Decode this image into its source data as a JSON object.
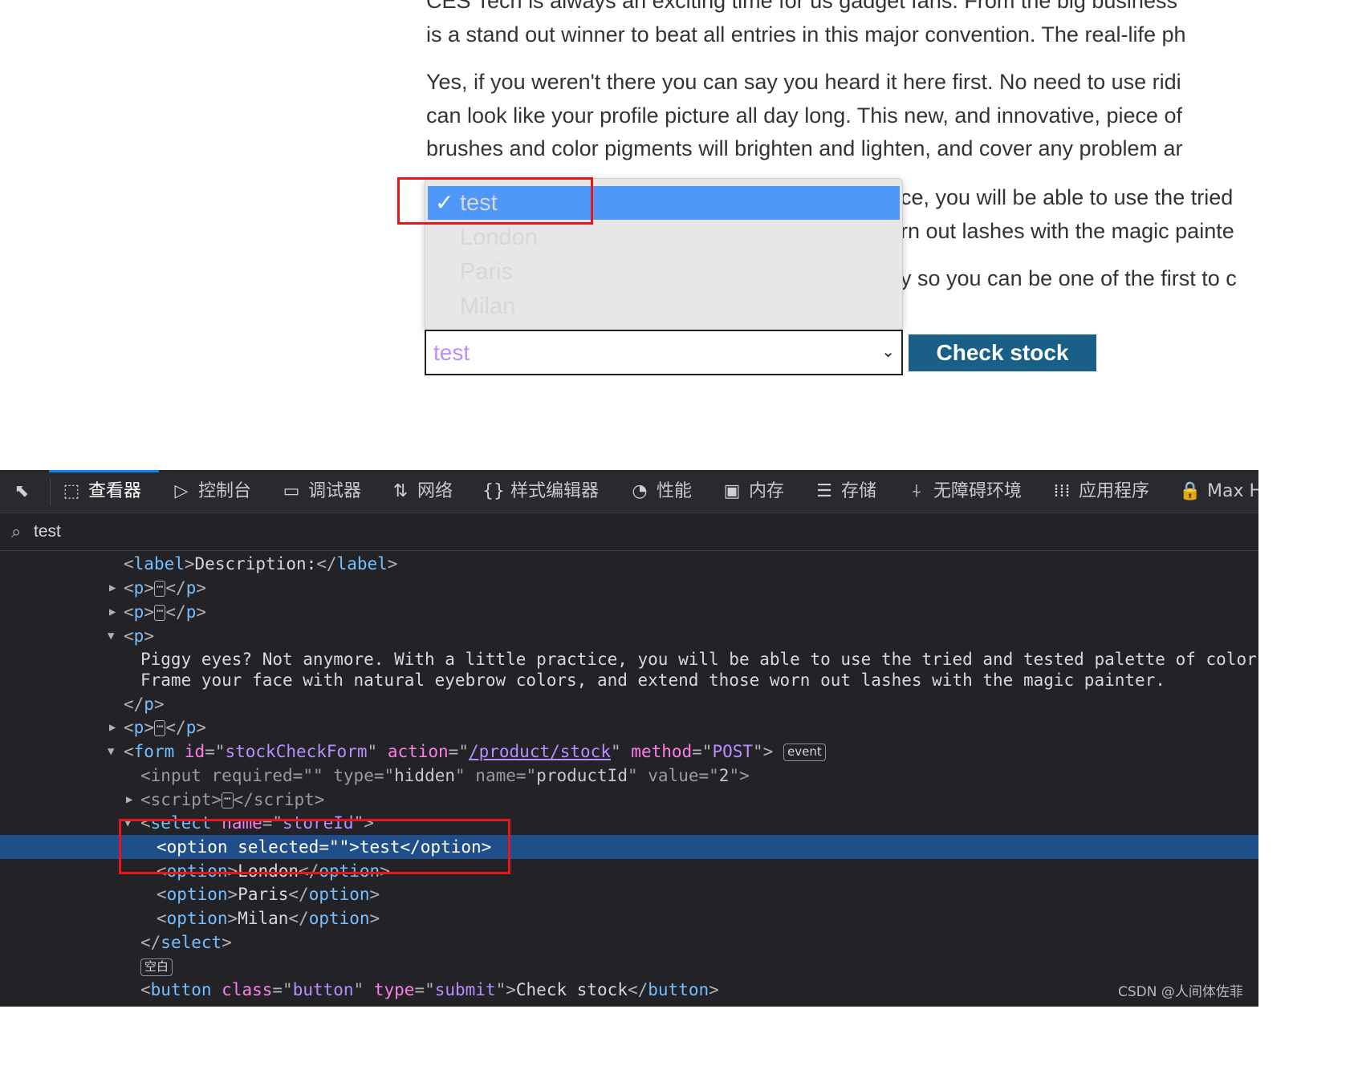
{
  "page": {
    "paragraphs": [
      [
        "CES Tech is always an exciting time for us gadget fans. From the big business",
        "is a stand out winner to beat all entries in this major convention. The real-life ph"
      ],
      [
        "Yes, if you weren't there you can say you heard it here first. No need to use ridi",
        "can look like your profile picture all day long. This new, and innovative, piece of",
        "brushes and color pigments will brighten and lighten, and cover any problem ar"
      ],
      [
        "ce, you will be able to use the tried",
        "rn out lashes with the magic painte"
      ],
      [
        "y so you can be one of the first to c"
      ]
    ],
    "dropdown": {
      "options": [
        "test",
        "London",
        "Paris",
        "Milan"
      ],
      "selected_index": 0,
      "check_mark": "✓"
    },
    "select_value": "test",
    "check_stock_label": "Check stock"
  },
  "devtools": {
    "tabs": [
      {
        "label": "查看器",
        "icon": "inspector-icon",
        "glyph": "⬚",
        "active": true
      },
      {
        "label": "控制台",
        "icon": "console-icon",
        "glyph": "▷"
      },
      {
        "label": "调试器",
        "icon": "debugger-icon",
        "glyph": "▭"
      },
      {
        "label": "网络",
        "icon": "network-icon",
        "glyph": "⇅"
      },
      {
        "label": "样式编辑器",
        "icon": "style-editor-icon",
        "glyph": "{}"
      },
      {
        "label": "性能",
        "icon": "performance-icon",
        "glyph": "◔"
      },
      {
        "label": "内存",
        "icon": "memory-icon",
        "glyph": "▣"
      },
      {
        "label": "存储",
        "icon": "storage-icon",
        "glyph": "☰"
      },
      {
        "label": "无障碍环境",
        "icon": "accessibility-icon",
        "glyph": "⍭"
      },
      {
        "label": "应用程序",
        "icon": "application-icon",
        "glyph": "⁞⁞⁞"
      },
      {
        "label": "Max H",
        "icon": "lock-icon",
        "glyph": "🔒"
      }
    ],
    "search_value": "test",
    "code": {
      "label_text": "Description:",
      "p_text_1": "Piggy eyes? Not anymore. With a little practice, you will be able to use the tried and tested palette of colors to",
      "p_text_2": "Frame your face with natural eyebrow colors, and extend those worn out lashes with the magic painter.",
      "form_id": "stockCheckForm",
      "form_action": "/product/stock",
      "form_method": "POST",
      "event_badge": "event",
      "input_name": "productId",
      "input_value": "2",
      "input_type": "hidden",
      "select_name": "storeId",
      "options": [
        "test",
        "London",
        "Paris",
        "Milan"
      ],
      "whitespace_badge": "空白",
      "button_class": "button",
      "button_type": "submit",
      "button_text": "Check stock",
      "ellipsis": "⋯"
    }
  },
  "watermark": "CSDN @人间体佐菲"
}
